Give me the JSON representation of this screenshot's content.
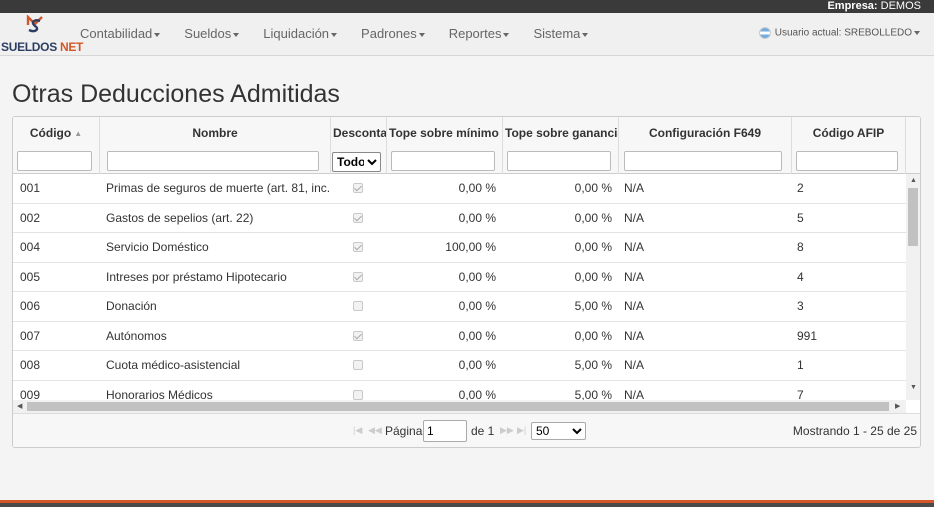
{
  "header": {
    "company_label": "Empresa:",
    "company_name": "DEMOS",
    "logo_text_left": "SUELDOS",
    "logo_text_right": "NET",
    "user_text": "Usuario actual: SREBOLLEDO"
  },
  "menu": [
    {
      "label": "Contabilidad"
    },
    {
      "label": "Sueldos"
    },
    {
      "label": "Liquidación"
    },
    {
      "label": "Padrones"
    },
    {
      "label": "Reportes"
    },
    {
      "label": "Sistema"
    }
  ],
  "page_title": "Otras Deducciones Admitidas",
  "columns": {
    "codigo": "Código",
    "nombre": "Nombre",
    "descontar": "Descontar g",
    "tope_minimo": "Tope sobre mínimo no",
    "tope_ganancia": "Tope sobre ganancia ne",
    "f649": "Configuración F649",
    "afip": "Código AFIP"
  },
  "filters": {
    "descontar_selected": "Todo"
  },
  "rows": [
    {
      "codigo": "001",
      "nombre": "Primas de seguros de muerte (art. 81, inc. b)",
      "descontar": true,
      "tope_minimo": "0,00 %",
      "tope_ganancia": "0,00 %",
      "f649": "N/A",
      "afip": "2"
    },
    {
      "codigo": "002",
      "nombre": "Gastos de sepelios (art. 22)",
      "descontar": true,
      "tope_minimo": "0,00 %",
      "tope_ganancia": "0,00 %",
      "f649": "N/A",
      "afip": "5"
    },
    {
      "codigo": "004",
      "nombre": "Servicio Doméstico",
      "descontar": true,
      "tope_minimo": "100,00 %",
      "tope_ganancia": "0,00 %",
      "f649": "N/A",
      "afip": "8"
    },
    {
      "codigo": "005",
      "nombre": "Intreses por préstamo Hipotecario",
      "descontar": true,
      "tope_minimo": "0,00 %",
      "tope_ganancia": "0,00 %",
      "f649": "N/A",
      "afip": "4"
    },
    {
      "codigo": "006",
      "nombre": "Donación",
      "descontar": false,
      "tope_minimo": "0,00 %",
      "tope_ganancia": "5,00 %",
      "f649": "N/A",
      "afip": "3"
    },
    {
      "codigo": "007",
      "nombre": "Autónomos",
      "descontar": true,
      "tope_minimo": "0,00 %",
      "tope_ganancia": "0,00 %",
      "f649": "N/A",
      "afip": "991"
    },
    {
      "codigo": "008",
      "nombre": "Cuota médico-asistencial",
      "descontar": false,
      "tope_minimo": "0,00 %",
      "tope_ganancia": "5,00 %",
      "f649": "N/A",
      "afip": "1"
    },
    {
      "codigo": "009",
      "nombre": "Honorarios Médicos",
      "descontar": false,
      "tope_minimo": "0,00 %",
      "tope_ganancia": "5,00 %",
      "f649": "N/A",
      "afip": "7"
    }
  ],
  "pager": {
    "page_label": "Página",
    "page_value": "1",
    "of_label": "de 1",
    "page_size": "50",
    "records": "Mostrando 1 - 25 de 25"
  }
}
